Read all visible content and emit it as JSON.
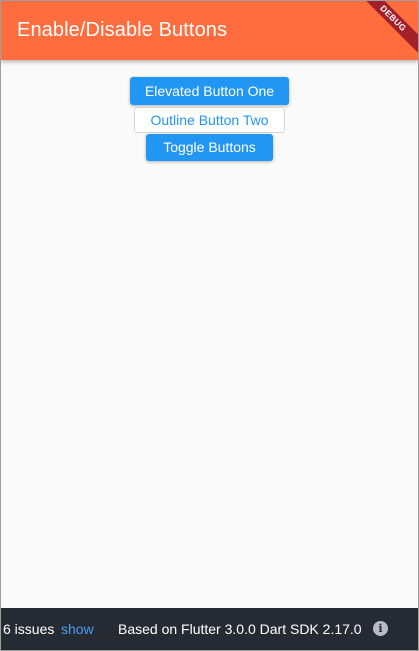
{
  "app": {
    "title": "Enable/Disable Buttons",
    "debug_banner": "DEBUG",
    "colors": {
      "app_bar": "#ff6d3f",
      "button_primary": "#2196f3",
      "status_bar": "#262b33",
      "debug_banner": "#a2202a"
    }
  },
  "buttons": {
    "elevated": "Elevated Button One",
    "outline": "Outline Button Two",
    "toggle": "Toggle Buttons"
  },
  "status_bar": {
    "issues_text": "6 issues",
    "show_link": "show",
    "info_text": "Based on Flutter 3.0.0 Dart SDK 2.17.0",
    "info_icon": "info-icon",
    "info_glyph": "i"
  }
}
